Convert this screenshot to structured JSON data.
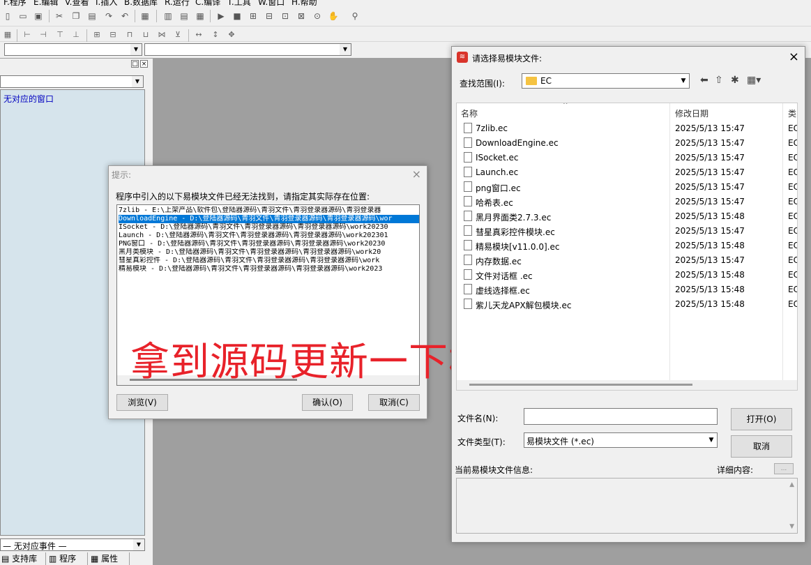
{
  "menu": [
    "F.程序",
    "E.编辑",
    "V.查看",
    "I.插入",
    "B.数据库",
    "R.运行",
    "C.编译",
    "T.工具",
    "W.窗口",
    "H.帮助"
  ],
  "left_panel": {
    "list_item": "无对应的窗口",
    "bottom_combo": "— 无对应事件 —",
    "tabs": [
      "支持库",
      "程序",
      "属性"
    ]
  },
  "prompt_dialog": {
    "title": "提示:",
    "message": "程序中引入的以下易模块文件已经无法找到，请指定其实际存在位置:",
    "rows": [
      "7zlib - E:\\上架产品\\软件包\\登陆器源码\\青羽文件\\青羽登录器源码\\青羽登录器",
      "DownloadEngine - D:\\登陆器源码\\青羽文件\\青羽登录器源码\\青羽登录器源码\\wor",
      "ISocket - D:\\登陆器源码\\青羽文件\\青羽登录器源码\\青羽登录器源码\\work20230",
      "Launch - D:\\登陆器源码\\青羽文件\\青羽登录器源码\\青羽登录器源码\\work202301",
      "PNG窗口 - D:\\登陆器源码\\青羽文件\\青羽登录器源码\\青羽登录器源码\\work20230",
      "黑月类模块 - D:\\登陆器源码\\青羽文件\\青羽登录器源码\\青羽登录器源码\\work20",
      "彗星真彩控件 - D:\\登陆器源码\\青羽文件\\青羽登录器源码\\青羽登录器源码\\work",
      "精易模块 - D:\\登陆器源码\\青羽文件\\青羽登录器源码\\青羽登录器源码\\work2023"
    ],
    "selected_row": 1,
    "browse_label": "浏览(V)",
    "ok_label": "确认(O)",
    "cancel_label": "取消(C)"
  },
  "overlay_text": "拿到源码更新一下模块",
  "file_dialog": {
    "title": "请选择易模块文件:",
    "look_in_label": "查找范围(I):",
    "look_in_value": "EC",
    "columns": [
      "名称",
      "修改日期",
      "类"
    ],
    "files": [
      {
        "name": "7zlib.ec",
        "date": "2025/5/13 15:47",
        "type": "EC"
      },
      {
        "name": "DownloadEngine.ec",
        "date": "2025/5/13 15:47",
        "type": "EC"
      },
      {
        "name": "ISocket.ec",
        "date": "2025/5/13 15:47",
        "type": "EC"
      },
      {
        "name": "Launch.ec",
        "date": "2025/5/13 15:47",
        "type": "EC"
      },
      {
        "name": "png窗口.ec",
        "date": "2025/5/13 15:47",
        "type": "EC"
      },
      {
        "name": "哈希表.ec",
        "date": "2025/5/13 15:47",
        "type": "EC"
      },
      {
        "name": "黑月界面类2.7.3.ec",
        "date": "2025/5/13 15:48",
        "type": "EC"
      },
      {
        "name": "彗星真彩控件模块.ec",
        "date": "2025/5/13 15:47",
        "type": "EC"
      },
      {
        "name": "精易模块[v11.0.0].ec",
        "date": "2025/5/13 15:48",
        "type": "EC"
      },
      {
        "name": "内存数据.ec",
        "date": "2025/5/13 15:47",
        "type": "EC"
      },
      {
        "name": "文件对话框 .ec",
        "date": "2025/5/13 15:48",
        "type": "EC"
      },
      {
        "name": "虚线选择框.ec",
        "date": "2025/5/13 15:48",
        "type": "EC"
      },
      {
        "name": "紫儿天龙APX解包模块.ec",
        "date": "2025/5/13 15:48",
        "type": "EC"
      }
    ],
    "filename_label": "文件名(N):",
    "filename_value": "",
    "filetype_label": "文件类型(T):",
    "filetype_value": "易模块文件 (*.ec)",
    "open_label": "打开(O)",
    "cancel_label": "取消",
    "info_label": "当前易模块文件信息:",
    "details_label": "详细内容:",
    "details_button": "..."
  }
}
